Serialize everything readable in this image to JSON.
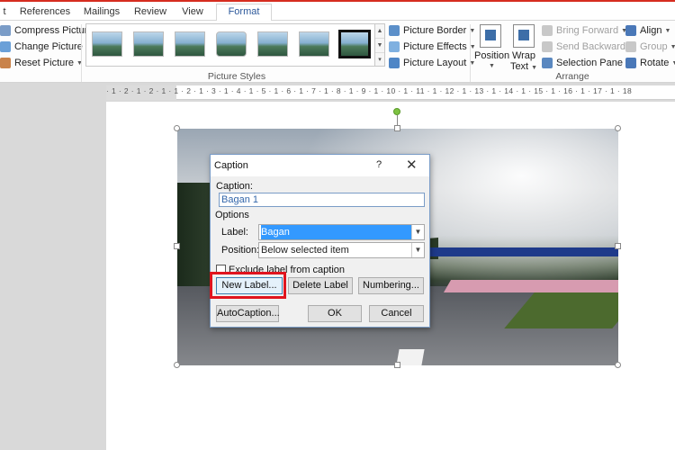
{
  "tabs": [
    {
      "label": "t"
    },
    {
      "label": "References"
    },
    {
      "label": "Mailings"
    },
    {
      "label": "Review"
    },
    {
      "label": "View"
    },
    {
      "label": "Format",
      "active": true
    }
  ],
  "ribbon": {
    "adjust": {
      "compress": "Compress Pictures",
      "change": "Change Picture",
      "reset": "Reset Picture"
    },
    "picture_styles": {
      "label": "Picture Styles",
      "border": "Picture Border",
      "effects": "Picture Effects",
      "layout": "Picture Layout"
    },
    "arrange": {
      "label": "Arrange",
      "position": "Position",
      "wrap_text_1": "Wrap",
      "wrap_text_2": "Text",
      "bring_forward": "Bring Forward",
      "send_backward": "Send Backward",
      "selection_pane": "Selection Pane",
      "align": "Align",
      "group": "Group",
      "rotate": "Rotate"
    }
  },
  "ruler": {
    "numbers": "· 1 · 2 · 1 · 2 · 1 · 1 · 2 · 1 · 3 · 1 · 4 · 1 · 5 · 1 · 6 · 1 · 7 · 1 · 8 · 1 · 9 · 1 · 10 · 1 · 11 · 1 · 12 · 1 · 13 · 1 · 14 · 1 · 15 · 1 · 16 · 1 · 17 · 1 · 18"
  },
  "dialog": {
    "title": "Caption",
    "help": "?",
    "close": "✕",
    "caption_label": "Caption:",
    "caption_value": "Bagan 1",
    "options_label": "Options",
    "label_label": "Label:",
    "label_value": "Bagan",
    "position_label": "Position:",
    "position_value": "Below selected item",
    "exclude_label": "Exclude label from caption",
    "new_label": "New Label...",
    "delete_label": "Delete Label",
    "numbering": "Numbering...",
    "autocaption": "AutoCaption...",
    "ok": "OK",
    "cancel": "Cancel"
  },
  "colors": {
    "accent": "#2b579a",
    "highlight": "#e0141e",
    "selection": "#3399ff"
  }
}
